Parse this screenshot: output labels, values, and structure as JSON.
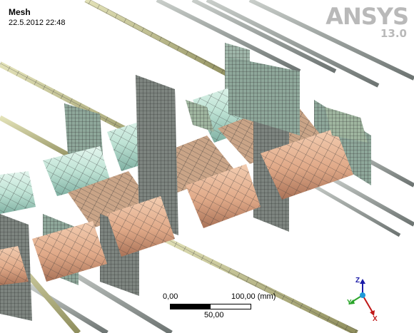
{
  "viewport": {
    "title": "Mesh",
    "timestamp": "22.5.2012 22:48"
  },
  "brand": {
    "logo": "ANSYS",
    "version": "13.0"
  },
  "scale": {
    "start": "0,00",
    "end": "100,00 (mm)",
    "mid": "50,00"
  },
  "triad": {
    "z": "Z",
    "y": "Y",
    "x": "X"
  },
  "colors": {
    "shaft": "#c7c68b",
    "shaft_steel": "#9aa09e",
    "flange": "#8ea79a",
    "wedge": "#c4a083",
    "cylinder_cyan": "#bfe6d6",
    "cylinder_tan": "#e7b494",
    "mesh_line": "#2e2e2e"
  }
}
